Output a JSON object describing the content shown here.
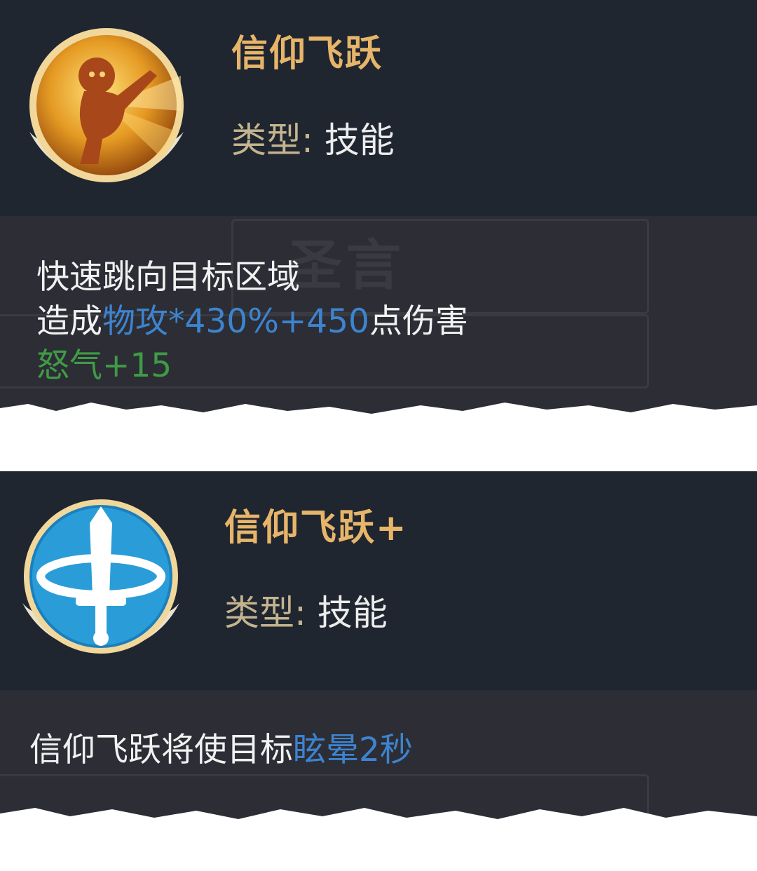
{
  "skills": [
    {
      "name": "信仰飞跃",
      "type_label": "类型:",
      "type_value": "技能",
      "icon": "leaping-hero-icon",
      "description": {
        "line1": "快速跳向目标区域",
        "line2_prefix": "造成",
        "line2_stat": "物攻*430%+450",
        "line2_suffix": "点伤害",
        "line3": "怒气+15"
      },
      "watermark": "圣言"
    },
    {
      "name": "信仰飞跃+",
      "type_label": "类型:",
      "type_value": "技能",
      "icon": "sword-ring-icon",
      "description": {
        "prefix": "信仰飞跃将使目标",
        "highlight": "眩晕2秒"
      }
    }
  ],
  "colors": {
    "header_bg": "#1f2630",
    "body_bg": "#2c2d35",
    "name_gold": "#e7b56a",
    "type_label": "#c4b48f",
    "stat_blue": "#3d84cf",
    "rage_green": "#3f9b45"
  }
}
